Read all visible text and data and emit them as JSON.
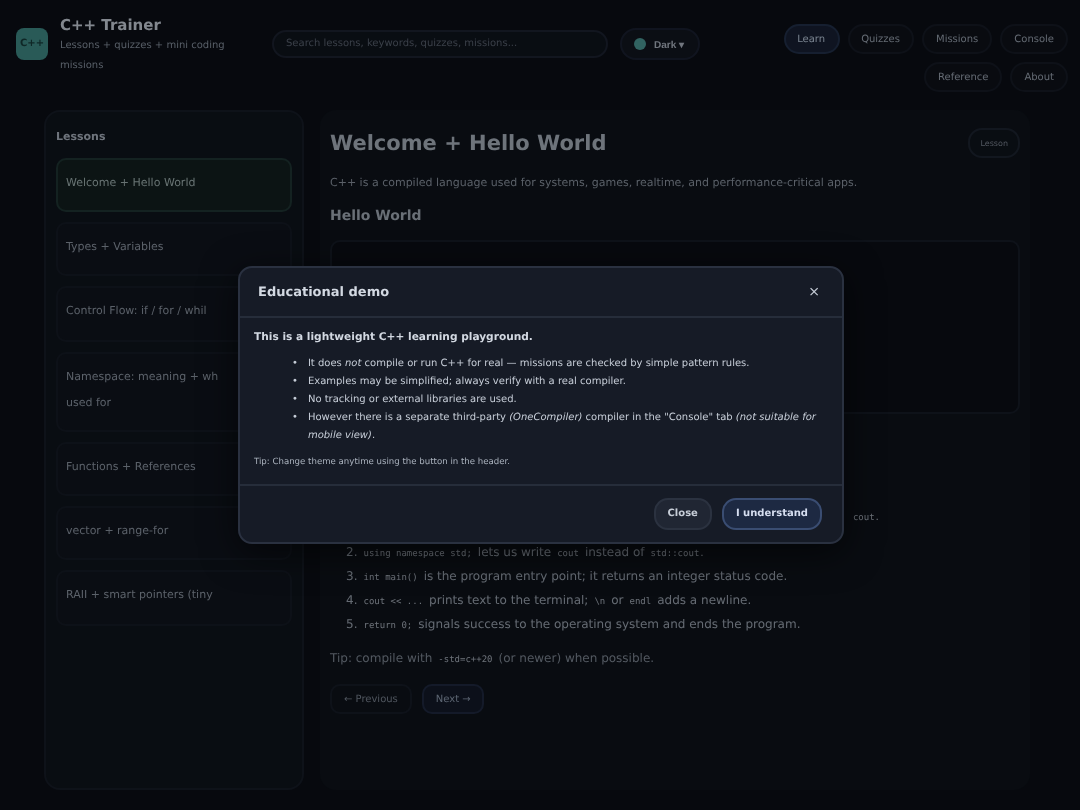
{
  "header": {
    "logo": "C++",
    "title": "C++ Trainer",
    "subtitle": "Lessons + quizzes + mini coding missions",
    "search": {
      "placeholder": "Search lessons, keywords, quizzes, missions..."
    },
    "theme": {
      "label": "Dark",
      "caret": "▾"
    },
    "nav": [
      {
        "label": "Learn",
        "selected": true
      },
      {
        "label": "Quizzes",
        "selected": false
      },
      {
        "label": "Missions",
        "selected": false
      },
      {
        "label": "Console",
        "selected": false
      },
      {
        "label": "Reference",
        "selected": false
      },
      {
        "label": "About",
        "selected": false
      }
    ]
  },
  "sidebar": {
    "title": "Lessons",
    "items": [
      {
        "label": "Welcome + Hello World",
        "selected": true
      },
      {
        "label": "Types + Variables",
        "selected": false
      },
      {
        "label": "Control Flow: if / for / whil",
        "selected": false
      },
      {
        "label": "Namespace: meaning + wh\nused for",
        "selected": false
      },
      {
        "label": "Functions + References",
        "selected": false
      },
      {
        "label": "vector + range-for",
        "selected": false
      },
      {
        "label": "RAII + smart pointers (tiny",
        "selected": false
      }
    ]
  },
  "lesson": {
    "title": "Welcome + Hello World",
    "badge": "Lesson",
    "intro": "C++ is a compiled language used for systems, games, realtime, and performance-critical apps.",
    "section": "Hello World",
    "steps": [
      [
        {
          "kind": "code",
          "text": "cout."
        }
      ],
      [
        {
          "kind": "text",
          "text": "2."
        },
        {
          "kind": "code",
          "text": "using namespace std;"
        },
        {
          "kind": "text",
          "text": "lets us write"
        },
        {
          "kind": "code",
          "text": "cout"
        },
        {
          "kind": "text",
          "text": "instead of"
        },
        {
          "kind": "code",
          "text": "std::cout."
        }
      ],
      [
        {
          "kind": "text",
          "text": "3."
        },
        {
          "kind": "code",
          "text": "int main()"
        },
        {
          "kind": "text",
          "text": "is the program entry point; it returns an integer status code."
        }
      ],
      [
        {
          "kind": "text",
          "text": "4."
        },
        {
          "kind": "code",
          "text": "cout << ..."
        },
        {
          "kind": "text",
          "text": "prints text to the terminal;"
        },
        {
          "kind": "code",
          "text": "\\n"
        },
        {
          "kind": "text",
          "text": "or"
        },
        {
          "kind": "code",
          "text": "endl"
        },
        {
          "kind": "text",
          "text": "adds a newline."
        }
      ],
      [
        {
          "kind": "text",
          "text": "5."
        },
        {
          "kind": "code",
          "text": "return 0;"
        },
        {
          "kind": "text",
          "text": "signals success to the operating system and ends the program."
        }
      ]
    ],
    "tip": [
      {
        "kind": "text",
        "text": "Tip: compile with"
      },
      {
        "kind": "code",
        "text": "-std=c++20"
      },
      {
        "kind": "text",
        "text": "(or newer) when possible."
      }
    ],
    "buttons": [
      {
        "label": "← Previous",
        "kind": "secondary"
      },
      {
        "label": "Next →",
        "kind": "primary"
      }
    ]
  },
  "modal": {
    "title": "Educational demo",
    "close": "×",
    "lead": "This is a lightweight C++ learning playground.",
    "bullets": [
      {
        "marker": "•",
        "text": "It does *not* compile or run C++ for real — missions are checked by simple pattern rules."
      },
      {
        "marker": "•",
        "text": "Examples may be simplified; always verify with a real compiler."
      },
      {
        "marker": "•",
        "text": "No tracking or external libraries are used."
      },
      {
        "marker": "•",
        "text": "However there is a separate third-party *(OneCompiler)* compiler in the \"Console\" tab *(not suitable for mobile view)*."
      }
    ],
    "tip": "Tip: Change theme anytime using the button in the header.",
    "buttons": [
      {
        "label": "Close",
        "kind": "secondary"
      },
      {
        "label": "I understand",
        "kind": "primary"
      }
    ]
  }
}
